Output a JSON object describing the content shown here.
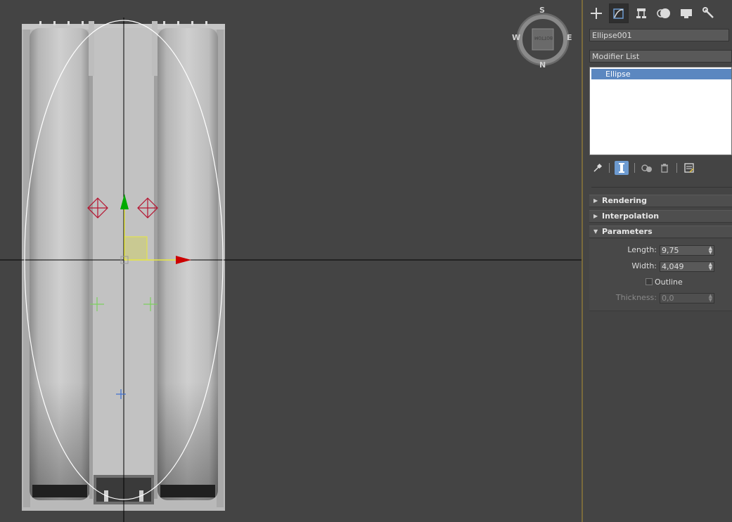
{
  "viewcube": {
    "north": "N",
    "south": "S",
    "east": "E",
    "west": "W",
    "face_label": "BOTTOM"
  },
  "command_panel": {
    "tabs": [
      {
        "name": "create-tab",
        "icon": "plus-icon"
      },
      {
        "name": "modify-tab",
        "icon": "modify-icon",
        "active": true
      },
      {
        "name": "hierarchy-tab",
        "icon": "hierarchy-icon"
      },
      {
        "name": "motion-tab",
        "icon": "motion-icon"
      },
      {
        "name": "display-tab",
        "icon": "display-icon"
      },
      {
        "name": "utilities-tab",
        "icon": "wrench-icon"
      }
    ],
    "object_name": "Ellipse001",
    "modifier_list_label": "Modifier List",
    "stack_items": [
      "Ellipse"
    ],
    "rollouts": {
      "rendering": "Rendering",
      "interpolation": "Interpolation",
      "parameters": "Parameters"
    },
    "parameters": {
      "length_label": "Length:",
      "length_value": "9,75",
      "width_label": "Width:",
      "width_value": "4,049",
      "outline_label": "Outline",
      "outline_checked": false,
      "thickness_label": "Thickness:",
      "thickness_value": "0,0"
    }
  },
  "colors": {
    "viewport_bg": "#444444",
    "selection_curve": "#ffffff",
    "axis_x": "#cc0000",
    "axis_y": "#00aa00",
    "accent_blue": "#5b87c0"
  }
}
